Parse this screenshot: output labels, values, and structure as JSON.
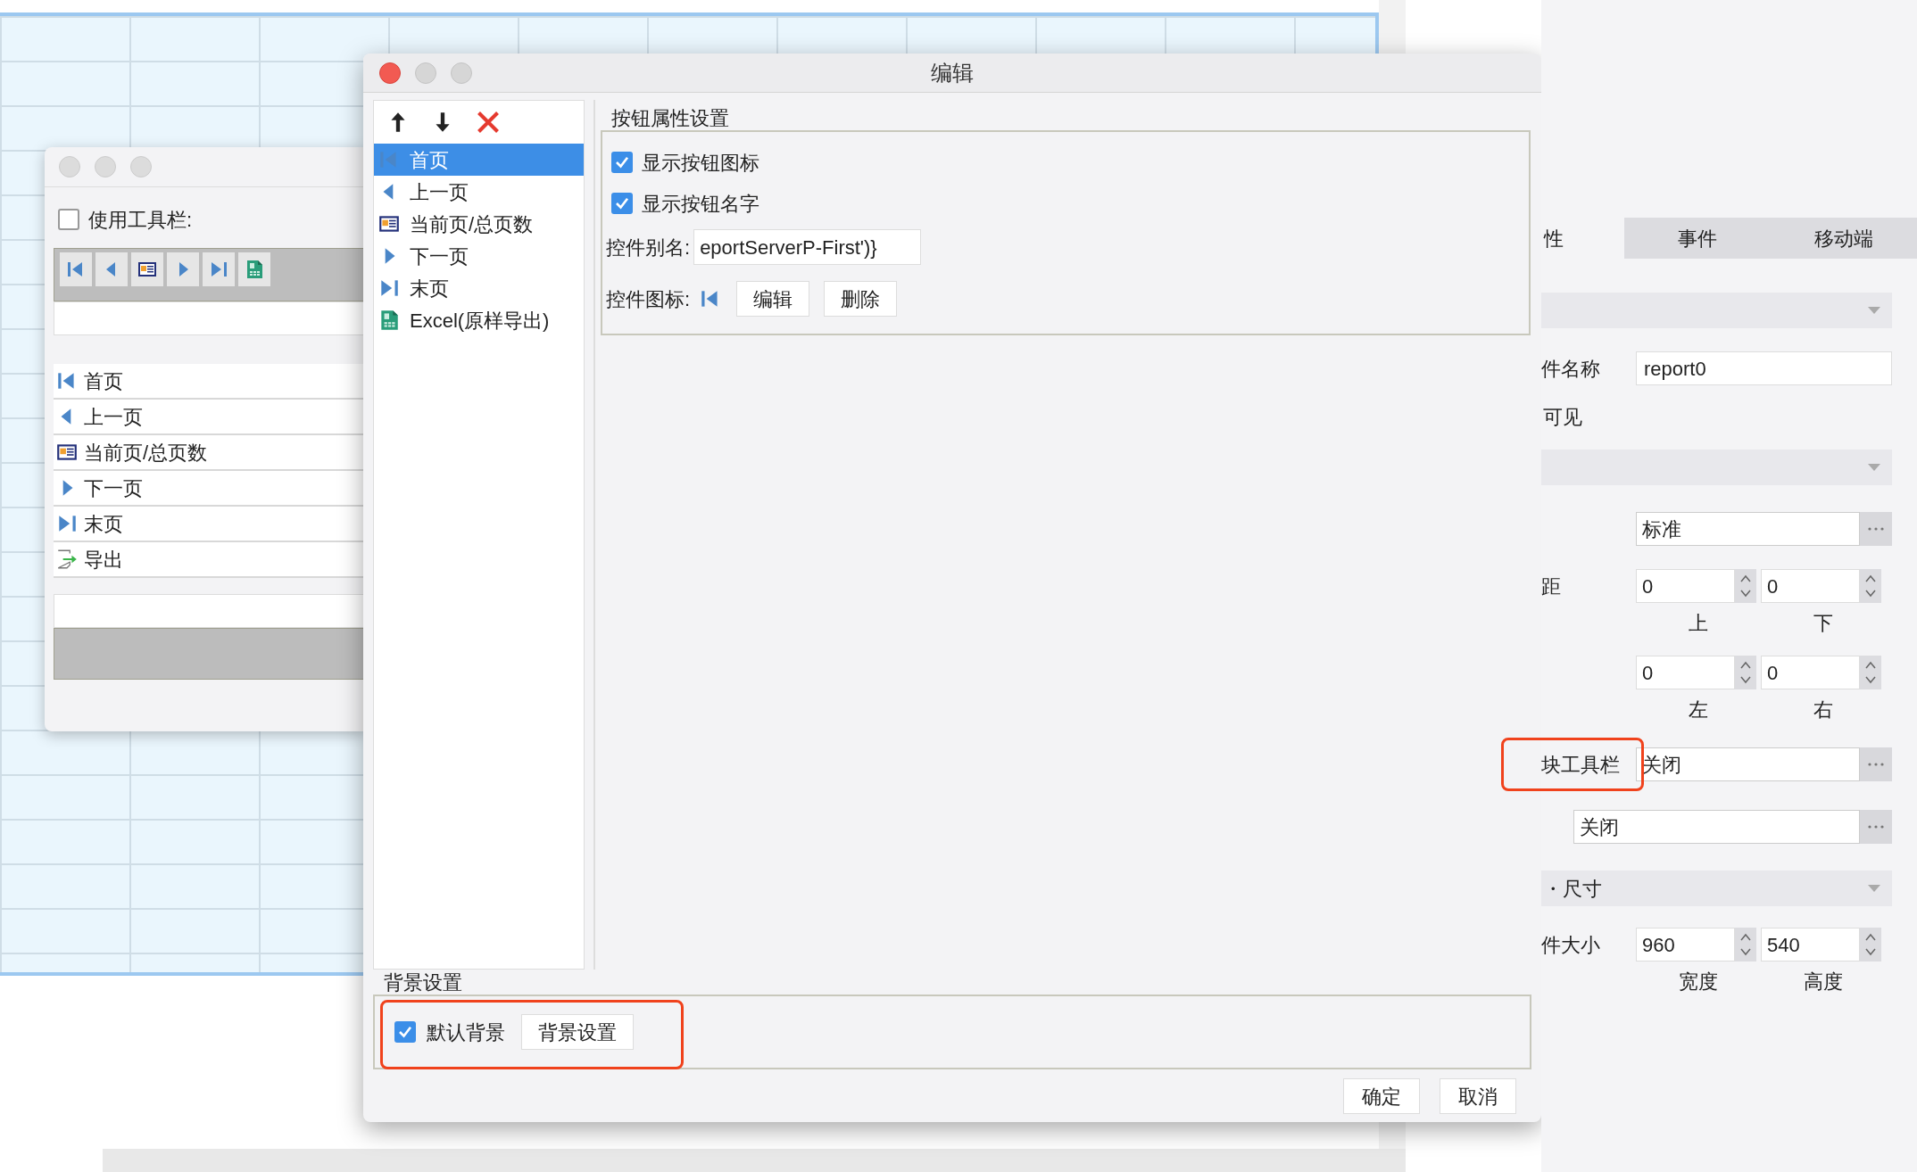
{
  "left_window": {
    "use_toolbar": {
      "label": "使用工具栏:",
      "checked": false
    },
    "toolbar_buttons": [
      {
        "kind": "first"
      },
      {
        "kind": "prev"
      },
      {
        "kind": "page"
      },
      {
        "kind": "next"
      },
      {
        "kind": "last"
      },
      {
        "kind": "excel"
      }
    ],
    "items": [
      {
        "kind": "first",
        "label": "首页"
      },
      {
        "kind": "prev",
        "label": "上一页"
      },
      {
        "kind": "page",
        "label": "当前页/总页数"
      },
      {
        "kind": "next",
        "label": "下一页"
      },
      {
        "kind": "last",
        "label": "末页"
      },
      {
        "kind": "export",
        "label": "导出"
      }
    ]
  },
  "dialog": {
    "title": "编辑",
    "tools": [
      {
        "kind": "up"
      },
      {
        "kind": "down"
      },
      {
        "kind": "delete"
      }
    ],
    "items": [
      {
        "kind": "first",
        "label": "首页",
        "selected": true
      },
      {
        "kind": "prev",
        "label": "上一页",
        "selected": false
      },
      {
        "kind": "page",
        "label": "当前页/总页数",
        "selected": false
      },
      {
        "kind": "next",
        "label": "下一页",
        "selected": false
      },
      {
        "kind": "last",
        "label": "末页",
        "selected": false
      },
      {
        "kind": "excel",
        "label": "Excel(原样导出)",
        "selected": false
      }
    ],
    "props": {
      "title": "按钮属性设置",
      "show_icon": {
        "label": "显示按钮图标",
        "checked": true
      },
      "show_name": {
        "label": "显示按钮名字",
        "checked": true
      },
      "alias": {
        "label": "控件别名:",
        "value": "eportServerP-First')}"
      },
      "icon": {
        "label": "控件图标:",
        "kind": "first",
        "buttons": [
          "编辑",
          "删除"
        ]
      }
    },
    "background": {
      "title": "背景设置",
      "default": {
        "label": "默认背景",
        "checked": true
      },
      "button": "背景设置",
      "highlighted": true
    },
    "buttons": [
      "确定",
      "取消"
    ]
  },
  "property_panel": {
    "tabs": [
      {
        "label": "性",
        "selected": true
      },
      {
        "label": "事件",
        "selected": false
      },
      {
        "label": "移动端",
        "selected": false
      }
    ],
    "rows": [
      {
        "kind": "section"
      },
      {
        "kind": "field",
        "label": "件名称",
        "value": "report0"
      },
      {
        "kind": "text",
        "label": "可见"
      },
      {
        "kind": "section"
      },
      {
        "kind": "select",
        "value": "标准",
        "highlighted": false
      },
      {
        "kind": "spin",
        "label": "距",
        "values": [
          "0",
          "0"
        ],
        "captions": [
          "上",
          "下"
        ]
      },
      {
        "kind": "spin",
        "values": [
          "0",
          "0"
        ],
        "captions": [
          "左",
          "右"
        ]
      },
      {
        "kind": "select",
        "label": "块工具栏",
        "value": "关闭",
        "highlighted": true
      },
      {
        "kind": "wide-select",
        "value": "关闭"
      },
      {
        "kind": "section",
        "label": "・尺寸"
      },
      {
        "kind": "spin",
        "label": "件大小",
        "values": [
          "960",
          "540"
        ],
        "captions": [
          "宽度",
          "高度"
        ]
      }
    ]
  }
}
